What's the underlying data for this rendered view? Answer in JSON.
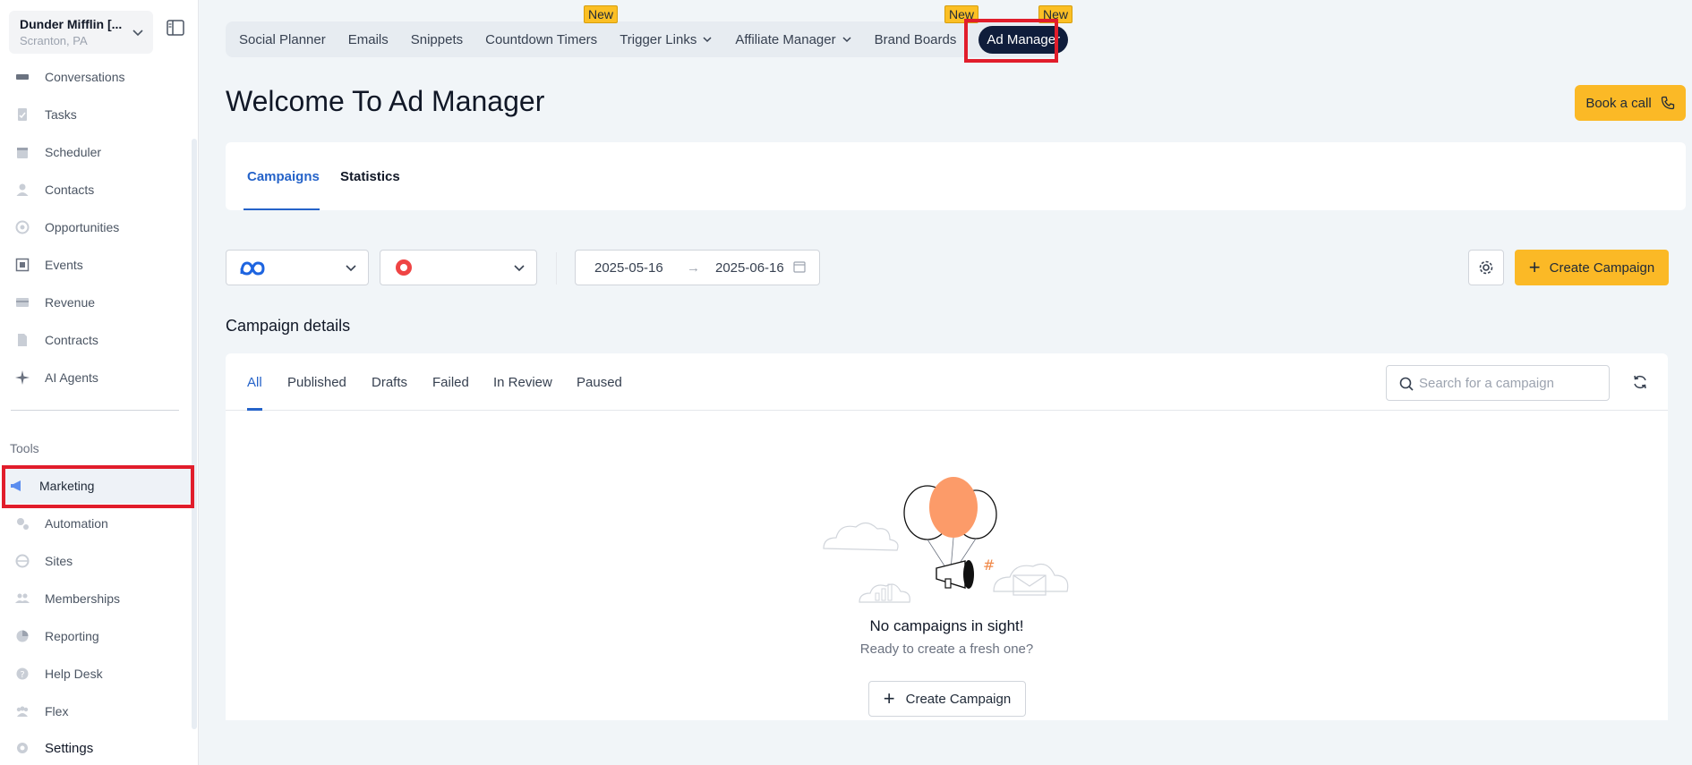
{
  "account": {
    "name": "Dunder Mifflin [...",
    "location": "Scranton, PA"
  },
  "sidebar": {
    "items": [
      {
        "label": "Conversations",
        "icon": "chat-icon"
      },
      {
        "label": "Tasks",
        "icon": "tasks-icon"
      },
      {
        "label": "Scheduler",
        "icon": "calendar-icon"
      },
      {
        "label": "Contacts",
        "icon": "person-icon"
      },
      {
        "label": "Opportunities",
        "icon": "target-icon"
      },
      {
        "label": "Events",
        "icon": "events-icon"
      },
      {
        "label": "Revenue",
        "icon": "card-icon"
      },
      {
        "label": "Contracts",
        "icon": "document-icon"
      },
      {
        "label": "AI Agents",
        "icon": "sparkle-icon"
      }
    ],
    "tools_label": "Tools",
    "tools": [
      {
        "label": "Marketing",
        "icon": "megaphone-icon"
      },
      {
        "label": "Automation",
        "icon": "gears-icon"
      },
      {
        "label": "Sites",
        "icon": "globe-icon"
      },
      {
        "label": "Memberships",
        "icon": "members-icon"
      },
      {
        "label": "Reporting",
        "icon": "pie-icon"
      },
      {
        "label": "Help Desk",
        "icon": "help-icon"
      },
      {
        "label": "Flex",
        "icon": "group-icon"
      },
      {
        "label": "Settings",
        "icon": "gear-icon"
      }
    ]
  },
  "topnav": {
    "tabs": [
      "Social Planner",
      "Emails",
      "Snippets",
      "Countdown Timers",
      "Trigger Links",
      "Affiliate Manager",
      "Brand Boards",
      "Ad Manager"
    ],
    "badge": "New"
  },
  "page": {
    "title": "Welcome To Ad Manager",
    "book_call": "Book a call"
  },
  "main_tabs": [
    "Campaigns",
    "Statistics"
  ],
  "filters": {
    "date_start": "2025-05-16",
    "date_end": "2025-06-16",
    "date_arrow": "→",
    "create_label": "Create Campaign"
  },
  "details": {
    "title": "Campaign details",
    "tabs": [
      "All",
      "Published",
      "Drafts",
      "Failed",
      "In Review",
      "Paused"
    ],
    "search_placeholder": "Search for a campaign",
    "empty_title": "No campaigns in sight!",
    "empty_sub": "Ready to create a fresh one?",
    "empty_button": "Create Campaign"
  },
  "colors": {
    "accent": "#fbb926",
    "active_tab": "#2563c9",
    "selected_pill": "#0f1d3b",
    "highlight": "#e11d2b"
  }
}
